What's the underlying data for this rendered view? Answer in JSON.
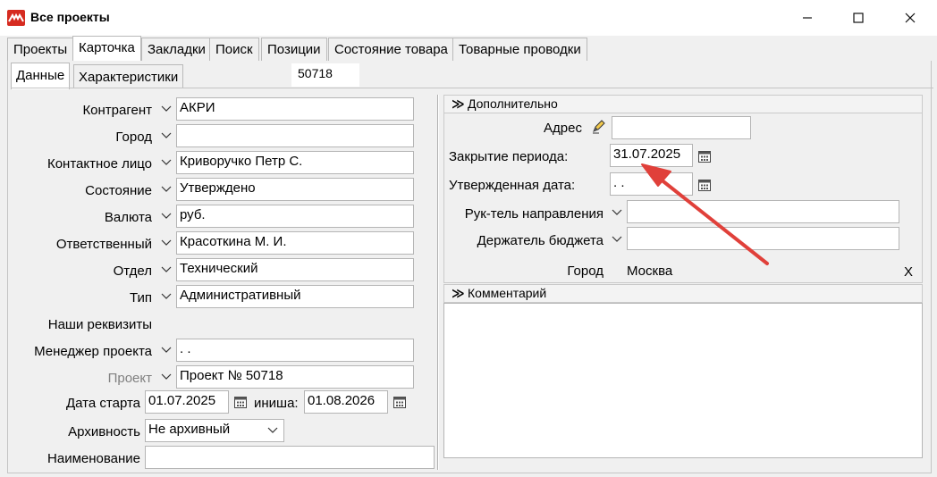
{
  "window": {
    "title": "Все проекты"
  },
  "tabs": [
    "Проекты",
    "Карточка",
    "Закладки",
    "Поиск",
    "Позиции",
    "Состояние товара",
    "Товарные проводки"
  ],
  "subtabs": [
    "Данные",
    "Характеристики"
  ],
  "project_number": "50718",
  "form": {
    "contractor": {
      "label": "Контрагент",
      "value": "АКРИ"
    },
    "city": {
      "label": "Город",
      "value": ""
    },
    "contact": {
      "label": "Контактное лицо",
      "value": "Криворучко Петр С."
    },
    "state": {
      "label": "Состояние",
      "value": "Утверждено"
    },
    "currency": {
      "label": "Валюта",
      "value": "руб."
    },
    "responsible": {
      "label": "Ответственный",
      "value": "Красоткина М. И."
    },
    "department": {
      "label": "Отдел",
      "value": "Технический"
    },
    "type": {
      "label": "Тип",
      "value": "Административный"
    },
    "our_details": {
      "label": "Наши реквизиты"
    },
    "manager": {
      "label": "Менеджер проекта",
      "value": ". ."
    },
    "project": {
      "label": "Проект",
      "value": "Проект № 50718"
    },
    "start_date": {
      "label": "Дата старта",
      "value": "01.07.2025"
    },
    "finish_date": {
      "label": "иниша:",
      "value": "01.08.2026"
    },
    "archive": {
      "label": "Архивность",
      "value": "Не архивный"
    },
    "name": {
      "label": "Наименование",
      "value": ""
    }
  },
  "extra": {
    "header": "Дополнительно",
    "address": {
      "label": "Адрес",
      "value": ""
    },
    "period_close": {
      "label": "Закрытие периода:",
      "value": "31.07.2025"
    },
    "approved_date": {
      "label": "Утвержденная дата:",
      "value": " .  ."
    },
    "direction_head": {
      "label": "Рук-тель направления",
      "value": ""
    },
    "budget_holder": {
      "label": "Держатель бюджета",
      "value": ""
    },
    "city": {
      "label": "Город",
      "value": "Москва",
      "clear": "X"
    }
  },
  "comment": {
    "header": "Комментарий"
  },
  "colors": {
    "logo": "#d62b20",
    "arrow": "#e0403a"
  },
  "icons": {
    "window": [
      "minimize-icon",
      "maximize-icon",
      "close-icon"
    ],
    "calendar": "calendar-icon",
    "edit": "pencil-icon",
    "dropdown": "chevron-down-icon",
    "collapse": "double-chevron-icon"
  }
}
